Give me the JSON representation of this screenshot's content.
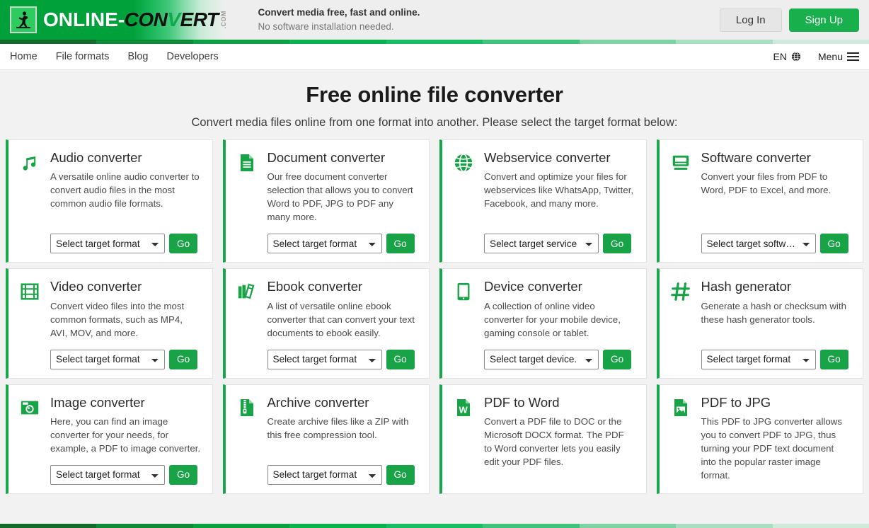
{
  "header": {
    "logo": {
      "icon": "running-man-icon",
      "online": "ONLINE",
      "dash": "-",
      "conv": "CON",
      "v": "V",
      "rt": "ERT",
      "dotcom": ".COM"
    },
    "tagline_line1": "Convert media free, fast and online.",
    "tagline_line2": "No software installation needed.",
    "login_label": "Log In",
    "signup_label": "Sign Up",
    "accent_green": "#18b04c"
  },
  "nav": {
    "links": [
      {
        "label": "Home"
      },
      {
        "label": "File formats"
      },
      {
        "label": "Blog"
      },
      {
        "label": "Developers"
      }
    ],
    "language": "EN",
    "language_icon": "globe-icon",
    "menu_label": "Menu",
    "menu_icon": "hamburger-icon"
  },
  "hero": {
    "title": "Free online file converter",
    "subtitle": "Convert media files online from one format into another. Please select the target format below:"
  },
  "gradient_strip": [
    "#146b2c",
    "#0f8a36",
    "#0ba143",
    "#0ab34e",
    "#18bd64",
    "#3fc37c",
    "#7ed2a3",
    "#a9dfc0",
    "#cfeada"
  ],
  "cards": [
    {
      "icon": "music-note-icon",
      "title": "Audio converter",
      "description": "A versatile online audio converter to convert audio files in the most common audio file formats.",
      "select_placeholder": "Select target format",
      "go_label": "Go",
      "has_form": true
    },
    {
      "icon": "document-icon",
      "title": "Document converter",
      "description": "Our free document converter selection that allows you to convert Word to PDF, JPG to PDF any many more.",
      "select_placeholder": "Select target format",
      "go_label": "Go",
      "has_form": true
    },
    {
      "icon": "globe-icon",
      "title": "Webservice converter",
      "description": "Convert and optimize your files for webservices like WhatsApp, Twitter, Facebook, and many more.",
      "select_placeholder": "Select target service",
      "go_label": "Go",
      "has_form": true
    },
    {
      "icon": "monitor-icon",
      "title": "Software converter",
      "description": "Convert your files from PDF to Word, PDF to Excel, and more.",
      "select_placeholder": "Select target software",
      "go_label": "Go",
      "has_form": true
    },
    {
      "icon": "film-strip-icon",
      "title": "Video converter",
      "description": "Convert video files into the most common formats, such as MP4, AVI, MOV, and more.",
      "select_placeholder": "Select target format",
      "go_label": "Go",
      "has_form": true
    },
    {
      "icon": "books-icon",
      "title": "Ebook converter",
      "description": "A list of versatile online ebook converter that can convert your text documents to ebook easily.",
      "select_placeholder": "Select target format",
      "go_label": "Go",
      "has_form": true
    },
    {
      "icon": "tablet-icon",
      "title": "Device converter",
      "description": "A collection of online video converter for your mobile device, gaming console or tablet.",
      "select_placeholder": "Select target device.",
      "go_label": "Go",
      "has_form": true
    },
    {
      "icon": "hash-icon",
      "title": "Hash generator",
      "description": "Generate a hash or checksum with these hash generator tools.",
      "select_placeholder": "Select target format",
      "go_label": "Go",
      "has_form": true
    },
    {
      "icon": "camera-icon",
      "title": "Image converter",
      "description": "Here, you can find an image converter for your needs, for example, a PDF to image converter.",
      "select_placeholder": "Select target format",
      "go_label": "Go",
      "has_form": true
    },
    {
      "icon": "zip-file-icon",
      "title": "Archive converter",
      "description": "Create archive files like a ZIP with this free compression tool.",
      "select_placeholder": "Select target format",
      "go_label": "Go",
      "has_form": true
    },
    {
      "icon": "word-file-icon",
      "title": "PDF to Word",
      "description": "Convert a PDF file to DOC or the Microsoft DOCX format. The PDF to Word converter lets you easily edit your PDF files.",
      "has_form": false
    },
    {
      "icon": "image-file-icon",
      "title": "PDF to JPG",
      "description": "This PDF to JPG converter allows you to convert PDF to JPG, thus turning your PDF text document into the popular raster image format.",
      "has_form": false
    }
  ]
}
